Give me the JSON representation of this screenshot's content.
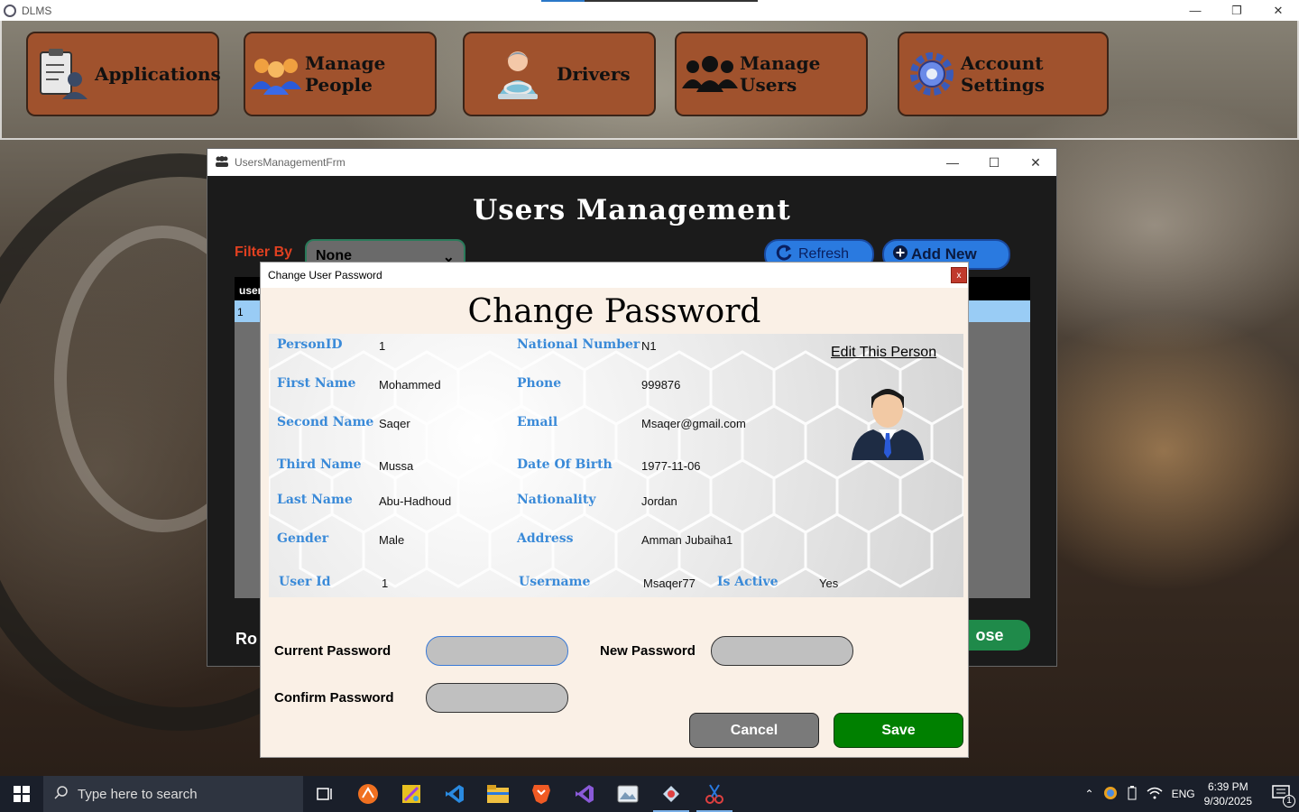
{
  "app": {
    "title": "DLMS"
  },
  "toolbar": {
    "applications": "Applications",
    "manage_people": "Manage People",
    "drivers": "Drivers",
    "manage_users": "Manage Users",
    "account_settings": "Account Settings"
  },
  "users_window": {
    "title": "UsersManagementFrm",
    "heading": "Users Management",
    "filter_label": "Filter By",
    "filter_value": "None",
    "refresh_label": "Refresh",
    "add_new_label": "Add New",
    "grid_header": "user",
    "grid_first_cell": "1",
    "rows_label": "Ro",
    "close_label": "ose"
  },
  "dialog": {
    "title": "Change User Password",
    "close_glyph": "x",
    "heading": "Change Password",
    "edit_person": "Edit This Person",
    "fields": {
      "person_id": {
        "label": "PersonID",
        "value": "1"
      },
      "national_number": {
        "label": "National Number",
        "value": "N1"
      },
      "first_name": {
        "label": "First Name",
        "value": "Mohammed"
      },
      "phone": {
        "label": "Phone",
        "value": "999876"
      },
      "second_name": {
        "label": "Second Name",
        "value": "Saqer"
      },
      "email": {
        "label": "Email",
        "value": "Msaqer@gmail.com"
      },
      "third_name": {
        "label": "Third Name",
        "value": "Mussa"
      },
      "date_of_birth": {
        "label": "Date Of Birth",
        "value": "1977-11-06"
      },
      "last_name": {
        "label": "Last Name",
        "value": "Abu-Hadhoud"
      },
      "nationality": {
        "label": "Nationality",
        "value": "Jordan"
      },
      "gender": {
        "label": "Gender",
        "value": "Male"
      },
      "address": {
        "label": "Address",
        "value": "Amman Jubaiha1"
      },
      "user_id": {
        "label": "User Id",
        "value": "1"
      },
      "username": {
        "label": "Username",
        "value": "Msaqer77"
      },
      "is_active": {
        "label": "Is Active",
        "value": "Yes"
      }
    },
    "password": {
      "current_label": "Current Password",
      "new_label": "New Password",
      "confirm_label": "Confirm Password",
      "current_value": "",
      "new_value": "",
      "confirm_value": ""
    },
    "cancel_label": "Cancel",
    "save_label": "Save"
  },
  "taskbar": {
    "search_placeholder": "Type here to search",
    "language": "ENG",
    "time": "6:39 PM",
    "date": "9/30/2025",
    "notification_count": "1"
  },
  "colors": {
    "toolbar_button": "#a0522d",
    "field_label": "#3a8ad8",
    "save_button": "#008000",
    "cancel_button": "#7a7a7a",
    "dialog_bg": "#faf0e6"
  }
}
